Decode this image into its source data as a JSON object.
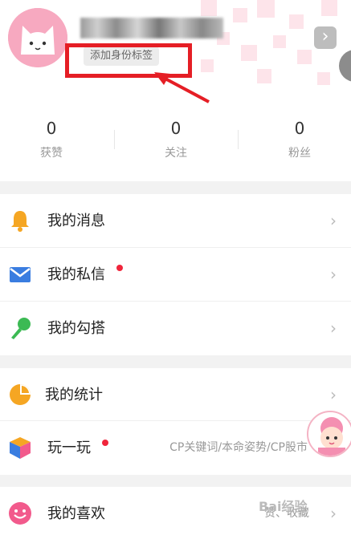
{
  "profile": {
    "username": "",
    "identity_tag": "添加身份标签"
  },
  "stats": [
    {
      "value": "0",
      "label": "获赞"
    },
    {
      "value": "0",
      "label": "关注"
    },
    {
      "value": "0",
      "label": "粉丝"
    }
  ],
  "menu_group1": [
    {
      "label": "我的消息",
      "icon": "bell-icon"
    },
    {
      "label": "我的私信",
      "icon": "mail-icon",
      "badge": true
    },
    {
      "label": "我的勾搭",
      "icon": "microphone-icon"
    }
  ],
  "menu_group2": [
    {
      "label": "我的统计",
      "icon": "pie-chart-icon"
    },
    {
      "label": "玩一玩",
      "icon": "cube-icon",
      "badge": true,
      "subtitle": "CP关键词/本命姿势/CP股市"
    }
  ],
  "menu_group3": [
    {
      "label": "我的喜欢",
      "icon": "smile-icon",
      "subtitle": "赞、收藏"
    }
  ],
  "chevron": "›",
  "watermark": "Bai经验",
  "colors": {
    "badge": "#f0253b",
    "annotation": "#e51e25",
    "bell": "#f5a623",
    "mail": "#3a7de0",
    "mic": "#3cba54",
    "pie": "#f5a623",
    "smile": "#f25a8c"
  }
}
